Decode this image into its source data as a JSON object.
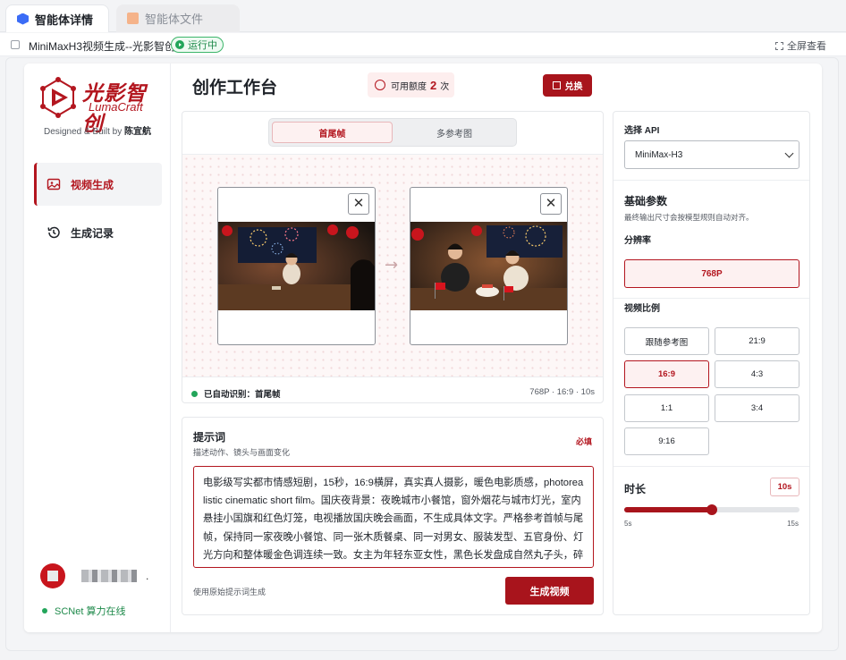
{
  "tabs": [
    {
      "label": "智能体详情",
      "icon": "hexagon-icon",
      "active": true
    },
    {
      "label": "智能体文件",
      "icon": "document-icon",
      "active": false
    }
  ],
  "window": {
    "title": "MiniMaxH3视频生成--光影智创",
    "status": "运行中",
    "fullscreen": "全屏查看"
  },
  "sidebar": {
    "logo_cn": "光影智创",
    "logo_en": "LumaCraft",
    "designed_prefix": "Designed & Built by ",
    "designed_name": "陈宜航",
    "items": [
      {
        "label": "视频生成",
        "icon": "video-image-icon",
        "active": true
      },
      {
        "label": "生成记录",
        "icon": "history-icon",
        "active": false
      }
    ],
    "user_suffix": ".",
    "compute_status": "SCNet 算力在线"
  },
  "header": {
    "title": "创作工作台",
    "quota_label": "可用额度",
    "quota_value": "2",
    "quota_unit": "次",
    "redeem_label": "兑换"
  },
  "frames": {
    "modes": [
      {
        "label": "首尾帧",
        "active": true
      },
      {
        "label": "多参考图",
        "active": false
      }
    ],
    "close_glyph": "✕",
    "arrow_glyph": "→",
    "status_text": "已自动识别：首尾帧",
    "spec_text": "768P · 16:9 · 10s"
  },
  "prompt": {
    "title": "提示词",
    "subtitle": "描述动作、镜头与画面变化",
    "required": "必填",
    "text": "电影级写实都市情感短剧，15秒，16:9横屏，真实真人摄影，暖色电影质感，photorealistic cinematic short film。国庆夜背景：夜晚城市小餐馆，窗外烟花与城市灯光，室内悬挂小国旗和红色灯笼，电视播放国庆晚会画面，不生成具体文字。严格参考首帧与尾帧，保持同一家夜晚小餐馆、同一张木质餐桌、同一对男女、服装发型、五官身份、灯光方向和整体暖金色调连续一致。女主为年轻东亚女性，黑色长发盘成自然丸子头，碎刘海，米白色针织开衫；男主为年轻东亚男性，黑色短发，深色上衣，禁止",
    "original_hint": "使用原始提示词生成",
    "generate_label": "生成视频"
  },
  "settings": {
    "api_label": "选择 API",
    "api_value": "MiniMax-H3",
    "basic_title": "基础参数",
    "basic_sub": "最终输出尺寸会按模型规则自动对齐。",
    "resolution_label": "分辨率",
    "resolution_value": "768P",
    "ratio_label": "视频比例",
    "ratios": [
      {
        "label": "跟随参考图",
        "active": false
      },
      {
        "label": "21:9",
        "active": false
      },
      {
        "label": "16:9",
        "active": true
      },
      {
        "label": "4:3",
        "active": false
      },
      {
        "label": "1:1",
        "active": false
      },
      {
        "label": "3:4",
        "active": false
      },
      {
        "label": "9:16",
        "active": false
      }
    ],
    "duration_label": "时长",
    "duration_value": "10s",
    "duration_min": "5s",
    "duration_max": "15s",
    "duration_fraction": 0.5
  },
  "colors": {
    "brand_red": "#a8141c",
    "online_green": "#22a55a"
  }
}
